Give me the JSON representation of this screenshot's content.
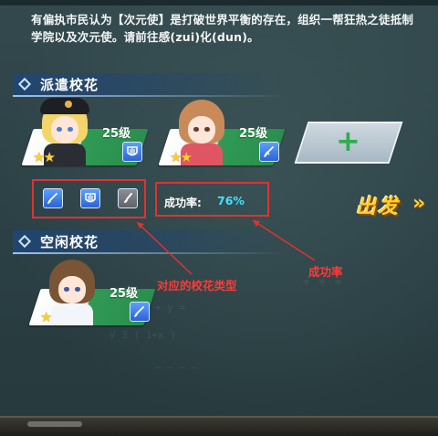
{
  "intro_text": "有偏执市民认为【次元使】是打破世界平衡的存在，组织一帮狂热之徒抵制学院以及次元使。请前往感(zui)化(dun)。",
  "dispatch_section": {
    "title": "派遣校花",
    "cards": [
      {
        "level": "25级",
        "stars": 2,
        "type_icon": "shield-type-icon",
        "hair_color": "#f3d56a",
        "outfit_color": "#2b2d35"
      },
      {
        "level": "25级",
        "stars": 2,
        "type_icon": "sword-type-icon",
        "hair_color": "#c98a5a",
        "outfit_color": "#e05563"
      }
    ],
    "add_slot_symbol": "+"
  },
  "type_icons": [
    "sword-type-icon",
    "shield-type-icon",
    "brush-type-icon"
  ],
  "success_rate": {
    "label": "成功率:",
    "value": "76%"
  },
  "go_button": {
    "label": "出发",
    "arrow": "»"
  },
  "idle_section": {
    "title": "空闲校花",
    "cards": [
      {
        "level": "25级",
        "stars": 1,
        "type_icon": "sword-type-icon",
        "hair_color": "#7a5535",
        "outfit_color": "#f2f5fa"
      }
    ]
  },
  "annotations": {
    "type_note": "对应的校花类型",
    "rate_note": "成功率"
  },
  "colors": {
    "accent_green": "#2f9a55",
    "rate_cyan": "#46e0ff",
    "annotation_red": "#e0332f",
    "star_gold": "#ffcf2e"
  }
}
